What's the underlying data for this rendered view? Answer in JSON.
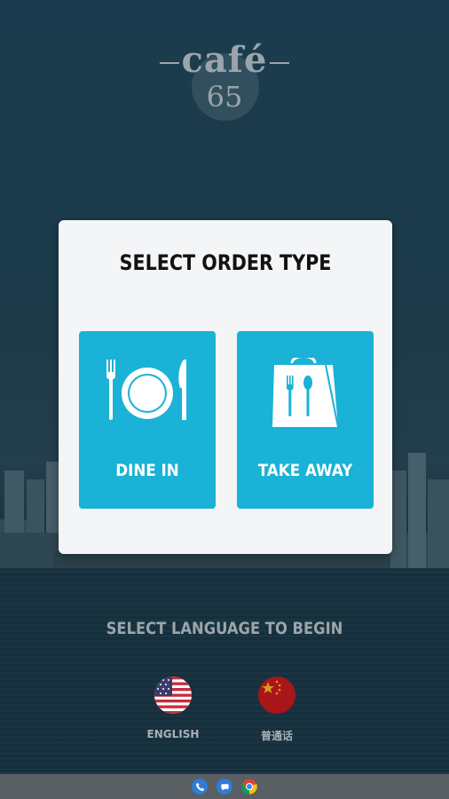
{
  "brand": {
    "name": "café",
    "number": "65"
  },
  "order_modal": {
    "title": "SELECT ORDER TYPE",
    "options": [
      {
        "label": "DINE IN",
        "icon": "plate-cutlery-icon"
      },
      {
        "label": "TAKE AWAY",
        "icon": "takeaway-bag-icon"
      }
    ]
  },
  "language": {
    "title": "SELECT LANGUAGE TO BEGIN",
    "options": [
      {
        "label": "ENGLISH",
        "icon": "us-flag-icon"
      },
      {
        "label": "普通话",
        "icon": "china-flag-icon"
      }
    ]
  },
  "system_nav": {
    "icons": [
      "phone-icon",
      "messages-icon",
      "chrome-icon"
    ]
  },
  "colors": {
    "accent": "#1ab2d6",
    "modal_bg": "#f3f5f7",
    "text_muted": "#9ba5aa"
  }
}
